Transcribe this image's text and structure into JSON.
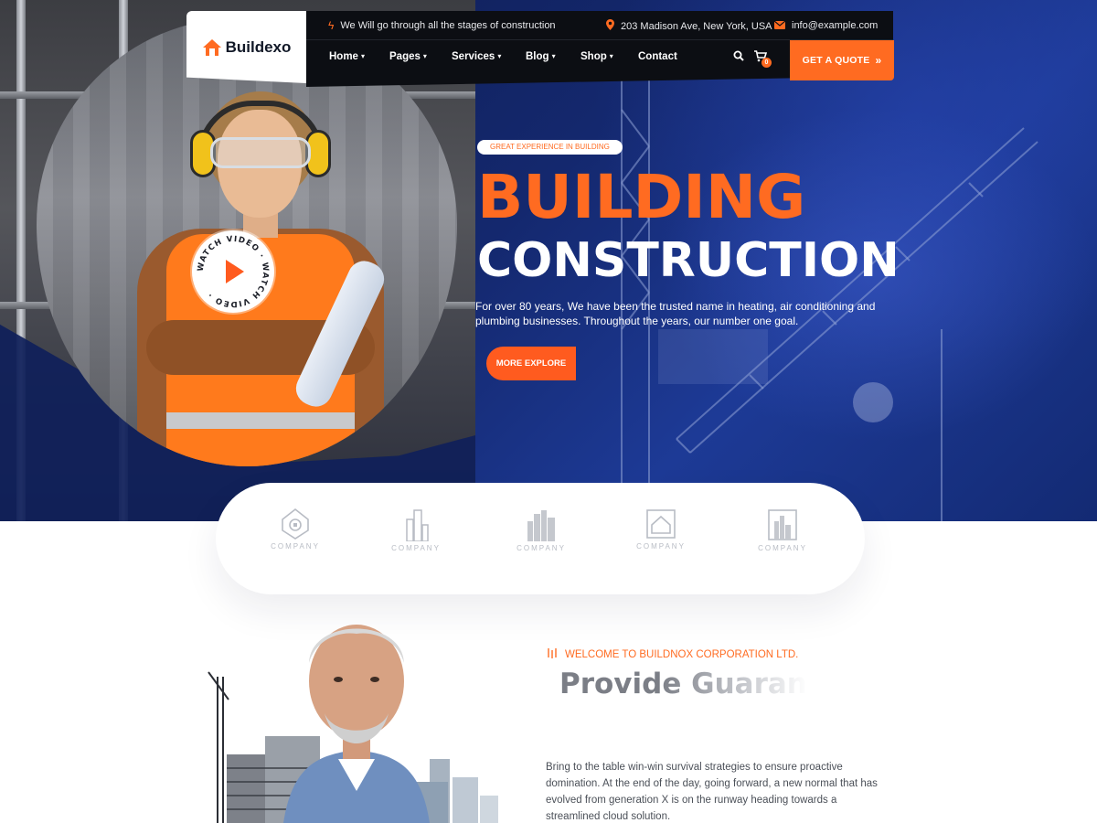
{
  "brand": {
    "name": "Buildexo",
    "accent": "#ff6b21",
    "dark": "#0c0e13",
    "navy": "#14286e"
  },
  "topbar": {
    "notice": "We Will go through all the stages of construction",
    "notice_icon": "bolt-icon",
    "address": "203 Madison Ave, New York, USA",
    "address_icon": "map-pin-icon",
    "email": "info@example.com",
    "email_icon": "envelope-icon"
  },
  "nav": {
    "items": [
      {
        "label": "Home",
        "has_dropdown": true
      },
      {
        "label": "Pages",
        "has_dropdown": true
      },
      {
        "label": "Services",
        "has_dropdown": true
      },
      {
        "label": "Blog",
        "has_dropdown": true
      },
      {
        "label": "Shop",
        "has_dropdown": true
      },
      {
        "label": "Contact",
        "has_dropdown": false
      }
    ],
    "cart_count": "0",
    "quote_label": "GET A QUOTE",
    "quote_icon": "double-chevron-right-icon"
  },
  "hero": {
    "tagline": "GREAT EXPERIENCE IN BUILDING",
    "title_line1": "BUILDING",
    "title_line2": "CONSTRUCTION",
    "description": "For over 80 years, We have been the trusted name in heating, air conditioning and plumbing businesses. Throughout the years, our number one goal.",
    "cta_label": "MORE EXPLORE",
    "watch_text": "WATCH VIDEO · WATCH VIDEO · "
  },
  "clients": [
    {
      "name": "COMPANY",
      "icon": "house-pin-logo"
    },
    {
      "name": "COMPANY",
      "icon": "tower-logo"
    },
    {
      "name": "COMPANY",
      "icon": "skyline-logo"
    },
    {
      "name": "COMPANY",
      "icon": "house-frame-logo"
    },
    {
      "name": "COMPANY",
      "icon": "buildings-box-logo"
    }
  ],
  "about": {
    "eyebrow": "WELCOME TO BUILDNOX CORPORATION LTD.",
    "heading": "Provide Guaran",
    "description": "Bring to the table win-win survival strategies to ensure proactive domination. At the end of the day, going forward, a new normal that has evolved from generation X is on the runway heading towards a streamlined cloud solution."
  }
}
